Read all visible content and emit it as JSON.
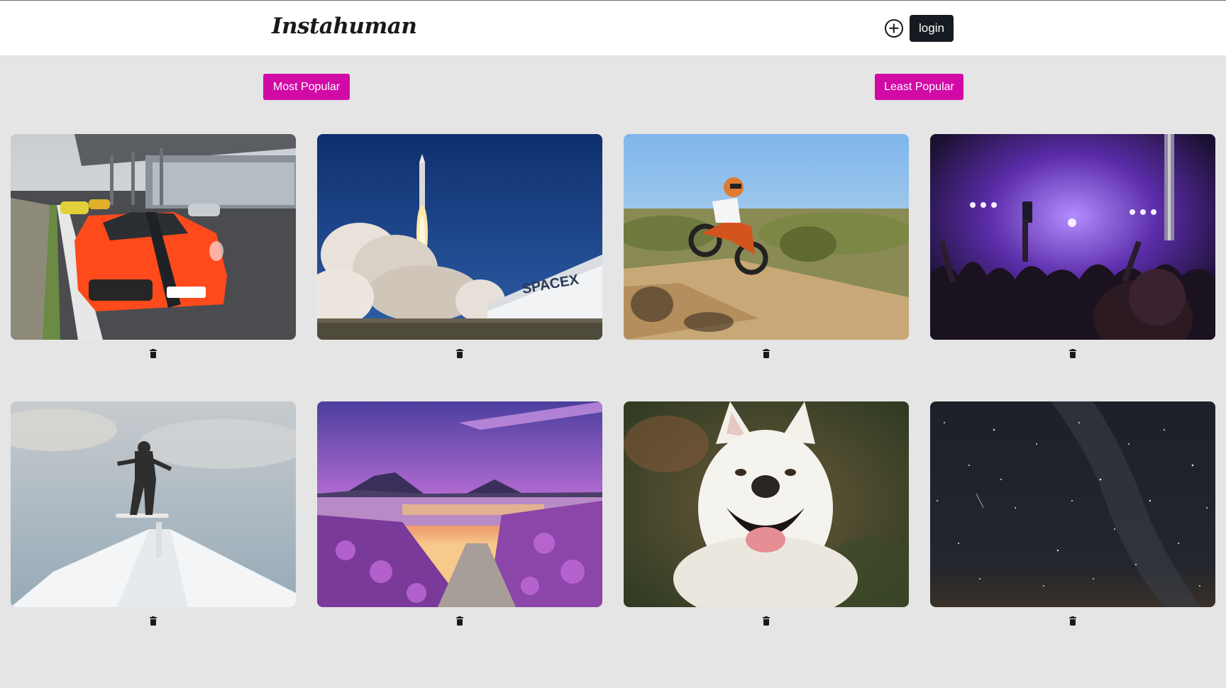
{
  "header": {
    "brand": "Instahuman",
    "add_icon": "plus-circle-icon",
    "login_label": "login"
  },
  "sort": {
    "most_popular_label": "Most Popular",
    "least_popular_label": "Least Popular",
    "accent_color": "#d10aa6"
  },
  "gallery": {
    "delete_icon": "trash-icon",
    "photos": [
      {
        "subject": "car",
        "delete_icon": "trash-icon"
      },
      {
        "subject": "rocket",
        "delete_icon": "trash-icon"
      },
      {
        "subject": "motocross",
        "delete_icon": "trash-icon"
      },
      {
        "subject": "concert",
        "delete_icon": "trash-icon"
      },
      {
        "subject": "snowboard",
        "delete_icon": "trash-icon"
      },
      {
        "subject": "lake-sunset",
        "delete_icon": "trash-icon"
      },
      {
        "subject": "husky",
        "delete_icon": "trash-icon"
      },
      {
        "subject": "night-sky",
        "delete_icon": "trash-icon"
      }
    ]
  },
  "photo_text": {
    "spacex_sign": "SPACEX"
  }
}
